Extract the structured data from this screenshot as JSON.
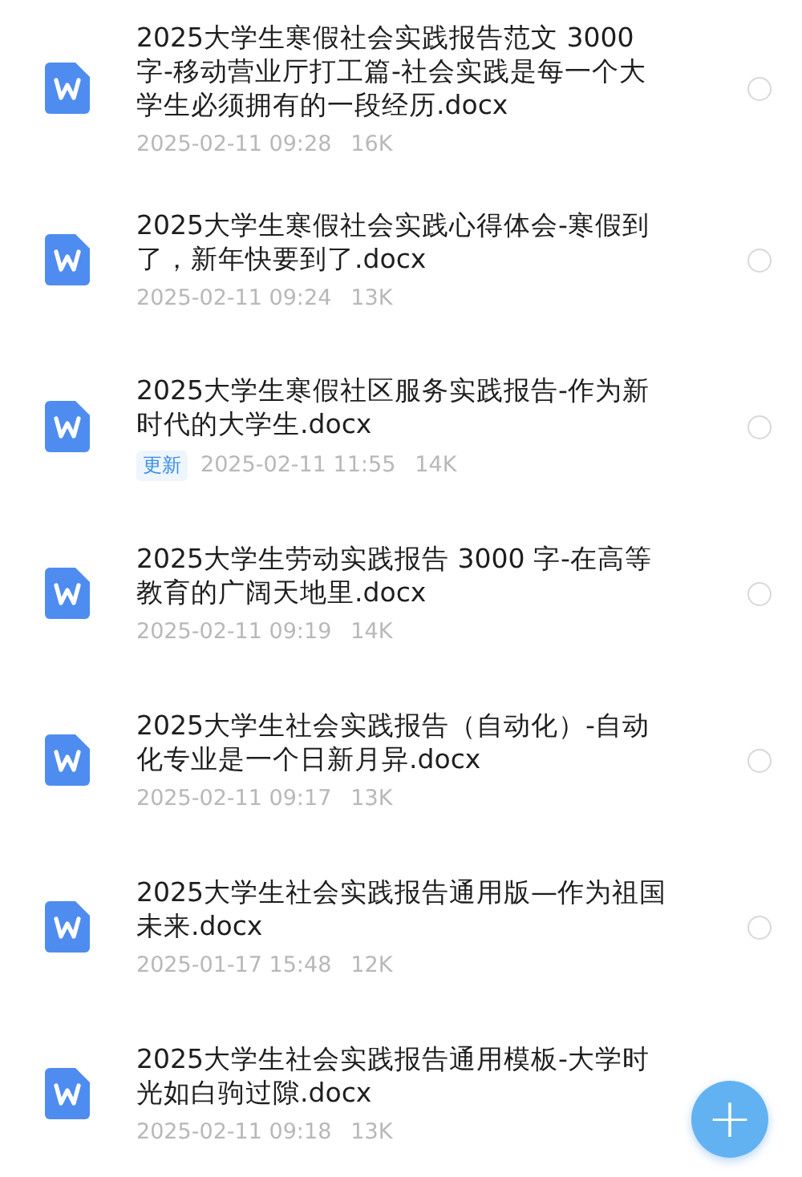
{
  "files": [
    {
      "name": "2025大学生寒假社会实践报告范文 3000 字-移动营业厅打工篇-社会实践是每一个大学生必须拥有的一段经历.docx",
      "date": "2025-02-11 09:28",
      "size": "16K",
      "selected": false
    },
    {
      "name": "2025大学生寒假社会实践心得体会-寒假到了，新年快要到了.docx",
      "date": "2025-02-11 09:24",
      "size": "13K",
      "selected": false
    },
    {
      "name": "2025大学生寒假社区服务实践报告-作为新时代的大学生.docx",
      "badge": "更新",
      "date": "2025-02-11 11:55",
      "size": "14K",
      "selected": false
    },
    {
      "name": "2025大学生劳动实践报告 3000 字-在高等教育的广阔天地里.docx",
      "date": "2025-02-11 09:19",
      "size": "14K",
      "selected": false
    },
    {
      "name": "2025大学生社会实践报告（自动化）-自动化专业是一个日新月异.docx",
      "date": "2025-02-11 09:17",
      "size": "13K",
      "selected": false
    },
    {
      "name": "2025大学生社会实践报告通用版—作为祖国未来.docx",
      "date": "2025-01-17 15:48",
      "size": "12K",
      "selected": false
    },
    {
      "name": "2025大学生社会实践报告通用模板-大学时光如白驹过隙.docx",
      "date": "2025-02-11 09:18",
      "size": "13K"
    }
  ],
  "fab": {
    "label": "+"
  }
}
